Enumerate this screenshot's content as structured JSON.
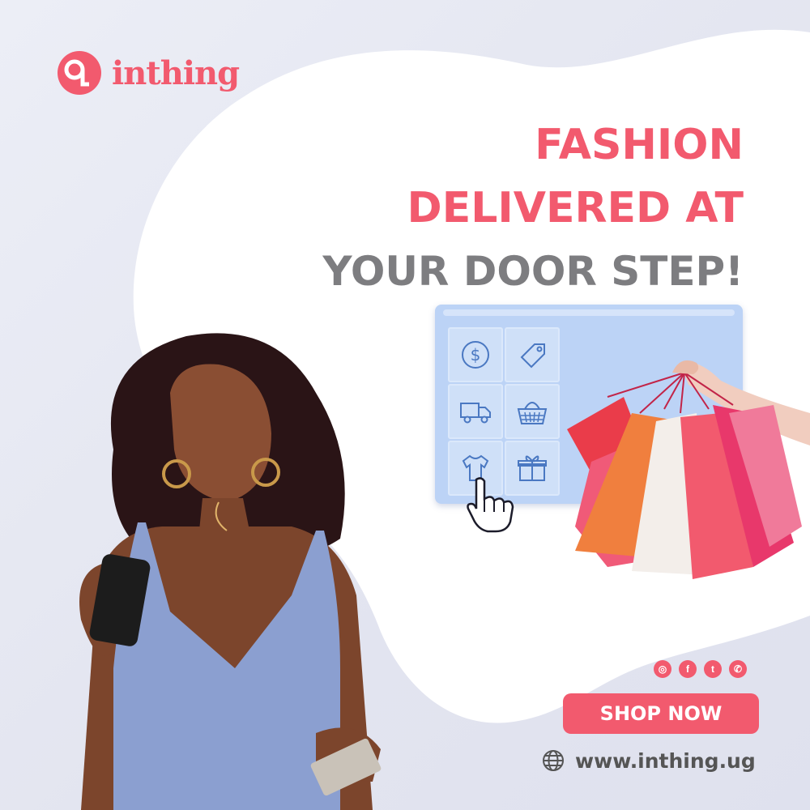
{
  "brand": {
    "name": "inthing",
    "color": "#f25a6e"
  },
  "headline": {
    "line1": "FASHION",
    "line2": "DELIVERED AT",
    "line3": "YOUR DOOR STEP!"
  },
  "screen_icons": [
    "dollar-icon",
    "tag-icon",
    "truck-icon",
    "basket-icon",
    "tshirt-icon",
    "gift-icon"
  ],
  "social": {
    "icons": [
      "instagram-icon",
      "facebook-icon",
      "twitter-icon",
      "whatsapp-icon"
    ]
  },
  "cta": {
    "label": "SHOP NOW"
  },
  "website": {
    "url": "www.inthing.ug"
  },
  "colors": {
    "accent": "#f25a6e",
    "gray_text": "#7d7d80",
    "screen": "#bcd3f6"
  }
}
